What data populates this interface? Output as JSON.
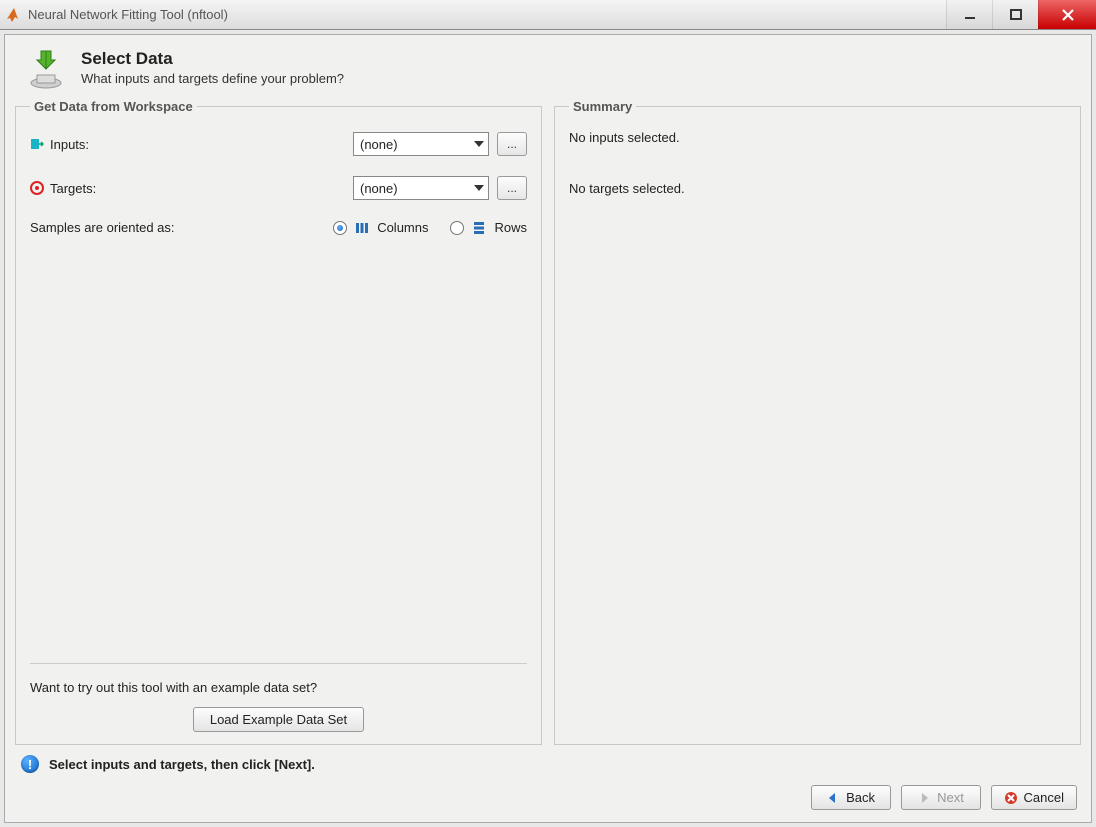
{
  "window": {
    "title": "Neural Network Fitting Tool (nftool)"
  },
  "header": {
    "title": "Select Data",
    "subtitle": "What inputs and targets define your problem?"
  },
  "left": {
    "legend": "Get Data from Workspace",
    "inputs_label": "Inputs:",
    "targets_label": "Targets:",
    "inputs_value": "(none)",
    "targets_value": "(none)",
    "browse_label": "...",
    "orient_label": "Samples are oriented as:",
    "columns_label": "Columns",
    "rows_label": "Rows",
    "example_prompt": "Want to try out this tool with an example data set?",
    "example_button": "Load Example Data Set"
  },
  "right": {
    "legend": "Summary",
    "no_inputs": "No inputs selected.",
    "no_targets": "No targets selected."
  },
  "status": {
    "message": "Select inputs and targets, then click [Next]."
  },
  "nav": {
    "back": "Back",
    "next": "Next",
    "cancel": "Cancel"
  }
}
